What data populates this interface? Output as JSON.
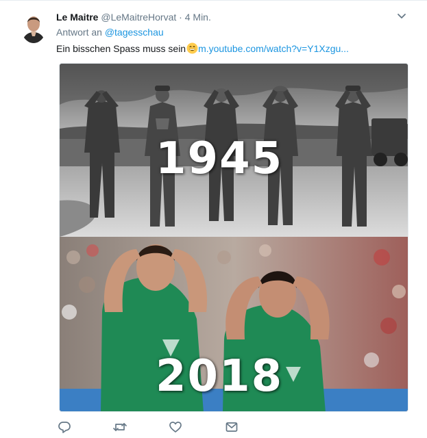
{
  "tweet": {
    "author_name": "Le Maitre",
    "author_handle": "@LeMaitreHorvat",
    "separator": "·",
    "time": "4 Min.",
    "reply_prefix": "Antwort an",
    "reply_to": "@tagesschau",
    "text": "Ein bisschen Spass muss sein",
    "link": "m.youtube.com/watch?v=Y1Xzgu..."
  },
  "media": {
    "top_caption": "1945",
    "bottom_caption": "2018"
  },
  "icons": {
    "caret": "chevron-down-icon",
    "reply": "reply-icon",
    "retweet": "retweet-icon",
    "like": "heart-icon",
    "message": "envelope-icon"
  },
  "colors": {
    "link": "#1b95e0",
    "muted": "#657786",
    "text": "#14171a"
  }
}
